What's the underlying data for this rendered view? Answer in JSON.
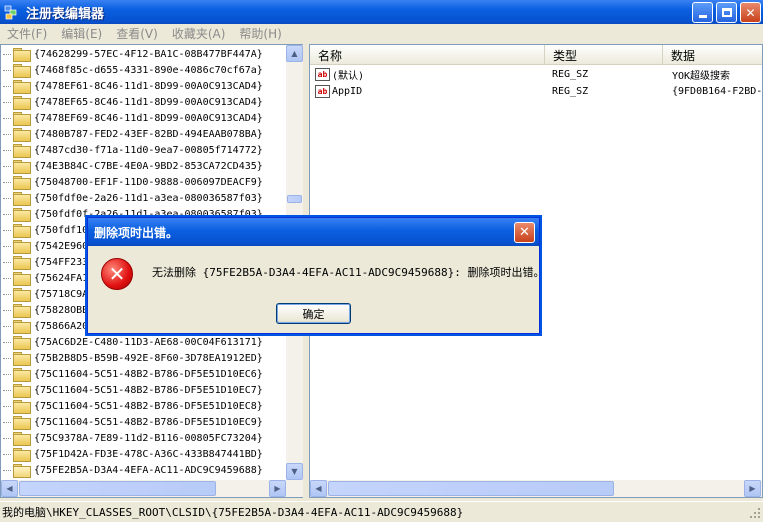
{
  "window": {
    "title": "注册表编辑器"
  },
  "menu": [
    "文件(F)",
    "编辑(E)",
    "查看(V)",
    "收藏夹(A)",
    "帮助(H)"
  ],
  "tree": {
    "items": [
      "{74628299-57EC-4F12-BA1C-08B477BF447A}",
      "{7468f85c-d655-4331-890e-4086c70cf67a}",
      "{7478EF61-8C46-11d1-8D99-00A0C913CAD4}",
      "{7478EF65-8C46-11d1-8D99-00A0C913CAD4}",
      "{7478EF69-8C46-11d1-8D99-00A0C913CAD4}",
      "{7480B787-FED2-43EF-82BD-494EAAB078BA}",
      "{7487cd30-f71a-11d0-9ea7-00805f714772}",
      "{74E3B84C-C7BE-4E0A-9BD2-853CA72CD435}",
      "{75048700-EF1F-11D0-9888-006097DEACF9}",
      "{750fdf0e-2a26-11d1-a3ea-080036587f03}",
      "{750fdf0f-2a26-11d1-a3ea-080036587f03}",
      "{750fdf10",
      "{7542E960",
      "{754FF233",
      "{75624FA1",
      "{75718C9A",
      "{75828OBB",
      "{75866A20",
      "{75AC6D2E-C480-11D3-AE68-00C04F613171}",
      "{75B2B8D5-B59B-492E-8F60-3D78EA1912ED}",
      "{75C11604-5C51-48B2-B786-DF5E51D10EC6}",
      "{75C11604-5C51-48B2-B786-DF5E51D10EC7}",
      "{75C11604-5C51-48B2-B786-DF5E51D10EC8}",
      "{75C11604-5C51-48B2-B786-DF5E51D10EC9}",
      "{75C9378A-7E89-11d2-B116-00805FC73204}",
      "{75F1D42A-FD3E-478C-A36C-433B847441BD}",
      "{75FE2B5A-D3A4-4EFA-AC11-ADC9C9459688}"
    ]
  },
  "list": {
    "columns": [
      "名称",
      "类型",
      "数据"
    ],
    "rows": [
      {
        "name": "(默认)",
        "type": "REG_SZ",
        "data": "YOK超级搜索"
      },
      {
        "name": "AppID",
        "type": "REG_SZ",
        "data": "{9FD0B164-F2BD-"
      }
    ]
  },
  "dialog": {
    "title": "删除项时出错。",
    "message": "无法删除 {75FE2B5A-D3A4-4EFA-AC11-ADC9C9459688}: 删除项时出错。",
    "ok_label": "确定"
  },
  "status": {
    "path": "我的电脑\\HKEY_CLASSES_ROOT\\CLSID\\{75FE2B5A-D3A4-4EFA-AC11-ADC9C9459688}"
  },
  "colors": {
    "title_blue": "#0a5fe0",
    "error_red": "#e01010",
    "window_bg": "#ece9d8"
  }
}
